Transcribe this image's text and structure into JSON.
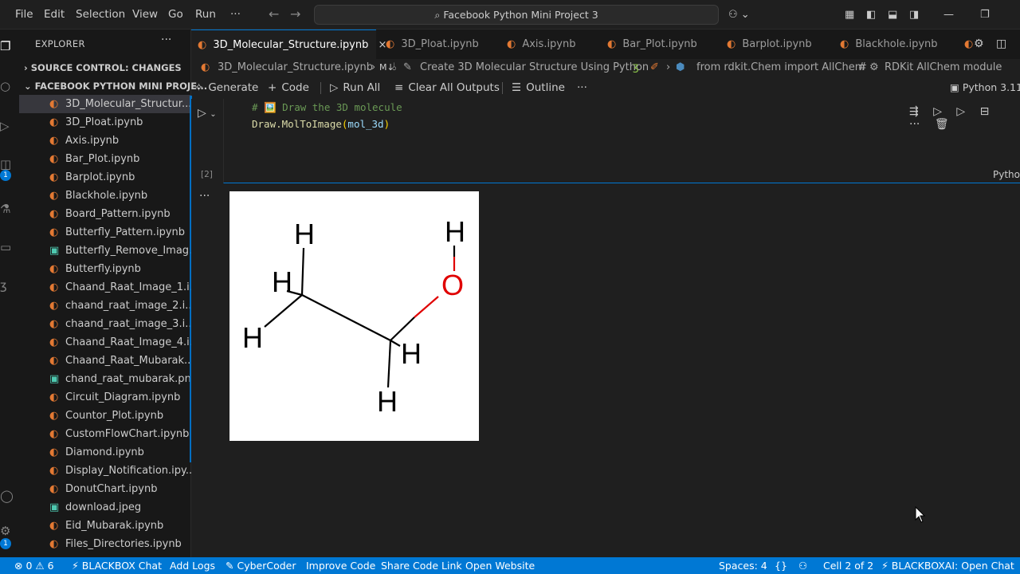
{
  "menu": [
    "File",
    "Edit",
    "Selection",
    "View",
    "Go",
    "Run",
    "···"
  ],
  "search": {
    "label": "Facebook Python Mini Project 3"
  },
  "explorer": {
    "header": "EXPLORER",
    "dots": "···",
    "source_control": "SOURCE CONTROL: CHANGES",
    "folder": "FACEBOOK PYTHON MINI PROJE...",
    "files": [
      {
        "name": "3D_Molecular_Structur...",
        "type": "notebook"
      },
      {
        "name": "3D_Ploat.ipynb",
        "type": "notebook"
      },
      {
        "name": "Axis.ipynb",
        "type": "notebook"
      },
      {
        "name": "Bar_Plot.ipynb",
        "type": "notebook"
      },
      {
        "name": "Barplot.ipynb",
        "type": "notebook"
      },
      {
        "name": "Blackhole.ipynb",
        "type": "notebook"
      },
      {
        "name": "Board_Pattern.ipynb",
        "type": "notebook"
      },
      {
        "name": "Butterfly_Pattern.ipynb",
        "type": "notebook"
      },
      {
        "name": "Butterfly_Remove_Imag...",
        "type": "image"
      },
      {
        "name": "Butterfly.ipynb",
        "type": "notebook"
      },
      {
        "name": "Chaand_Raat_Image_1.i...",
        "type": "notebook"
      },
      {
        "name": "chaand_raat_image_2.i...",
        "type": "notebook"
      },
      {
        "name": "chaand_raat_image_3.i...",
        "type": "notebook"
      },
      {
        "name": "Chaand_Raat_Image_4.i...",
        "type": "notebook"
      },
      {
        "name": "Chaand_Raat_Mubarak...",
        "type": "notebook"
      },
      {
        "name": "chand_raat_mubarak.png",
        "type": "image"
      },
      {
        "name": "Circuit_Diagram.ipynb",
        "type": "notebook"
      },
      {
        "name": "Countor_Plot.ipynb",
        "type": "notebook"
      },
      {
        "name": "CustomFlowChart.ipynb",
        "type": "notebook"
      },
      {
        "name": "Diamond.ipynb",
        "type": "notebook"
      },
      {
        "name": "Display_Notification.ipy...",
        "type": "notebook"
      },
      {
        "name": "DonutChart.ipynb",
        "type": "notebook"
      },
      {
        "name": "download.jpeg",
        "type": "image"
      },
      {
        "name": "Eid_Mubarak.ipynb",
        "type": "notebook"
      },
      {
        "name": "Files_Directories.ipynb",
        "type": "notebook"
      }
    ]
  },
  "tabs": [
    {
      "label": "3D_Molecular_Structure.ipynb",
      "active": true,
      "close": "×"
    },
    {
      "label": "3D_Ploat.ipynb"
    },
    {
      "label": "Axis.ipynb"
    },
    {
      "label": "Bar_Plot.ipynb"
    },
    {
      "label": "Barplot.ipynb"
    },
    {
      "label": "Blackhole.ipynb"
    }
  ],
  "breadcrumb": {
    "file": "3D_Molecular_Structure.ipynb",
    "md": "M↓",
    "heading": "Create 3D Molecular Structure Using Python",
    "code": "from rdkit.Chem import AllChem",
    "hash": "#",
    "module": "RDKit AllChem module"
  },
  "toolbar": {
    "generate": "Generate",
    "code": "Code",
    "run_all": "Run All",
    "clear_outputs": "Clear All Outputs",
    "outline": "Outline",
    "more": "···",
    "kernel": "Python 3.11"
  },
  "cell": {
    "comment": "# 🖼️ Draw the 3D molecule",
    "code_fn": "Draw.MolToImage",
    "code_arg": "mol_3d",
    "exec_count": "[2]",
    "language": "Python"
  },
  "molecule": {
    "atoms": [
      "H",
      "H",
      "H",
      "H",
      "H",
      "H",
      "O"
    ],
    "o_color": "#e00000"
  },
  "statusbar": {
    "problems": "0",
    "warnings": "0",
    "info": "6",
    "blackbox_chat": "BLACKBOX Chat",
    "add_logs": "Add Logs",
    "cybercoder": "CyberCoder",
    "improve_code": "Improve Code",
    "share_code_link": "Share Code Link",
    "open_website": "Open Website",
    "spaces": "Spaces: 4",
    "braces": "{}",
    "cell_pos": "Cell 2 of 2",
    "blackboxai": "BLACKBOXAI: Open Chat"
  },
  "colors": {
    "accent": "#0078d4",
    "notebook_icon": "#e37933",
    "image_icon": "#4ec9b0"
  }
}
